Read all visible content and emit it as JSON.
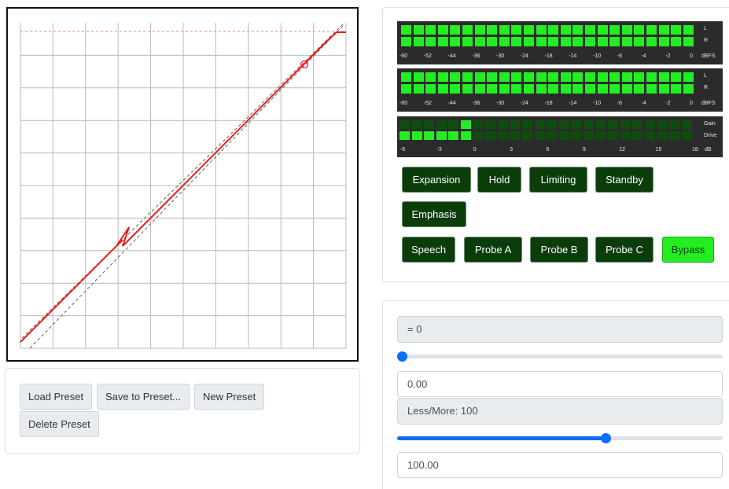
{
  "graph": {
    "grid_columns": 10,
    "grid_rows": 10
  },
  "presets": {
    "load": "Load Preset",
    "save": "Save to Preset...",
    "new": "New Preset",
    "delete": "Delete Preset"
  },
  "meters": {
    "output_1": {
      "channels": [
        "L",
        "R"
      ],
      "scale": [
        "-60",
        "-52",
        "-44",
        "-36",
        "-30",
        "-24",
        "-18",
        "-14",
        "-10",
        "-6",
        "-4",
        "-2",
        "0"
      ],
      "unit": "dBFS",
      "lit_fraction": 1.0
    },
    "output_2": {
      "channels": [
        "L",
        "R"
      ],
      "scale": [
        "-60",
        "-52",
        "-44",
        "-36",
        "-30",
        "-24",
        "-18",
        "-14",
        "-10",
        "-6",
        "-4",
        "-2",
        "0"
      ],
      "unit": "dBFS",
      "lit_fraction": 1.0
    },
    "gain_drive": {
      "channels": [
        "Gain",
        "Drive"
      ],
      "scale": [
        "-6",
        "-3",
        "0",
        "3",
        "6",
        "9",
        "12",
        "15",
        "18"
      ],
      "unit": "dB",
      "gain_lit_segments": 1,
      "drive_lit_segments": 6
    },
    "colors": {
      "lit": "#22ee22",
      "dim": "#0e4d0e",
      "bg": "#2b2b2b"
    }
  },
  "modes": {
    "row1": [
      "Expansion",
      "Hold",
      "Limiting",
      "Standby"
    ],
    "row2": [
      "Emphasis"
    ],
    "row3": [
      "Speech",
      "Probe A",
      "Probe B",
      "Probe C",
      "Bypass"
    ],
    "active": "Bypass"
  },
  "controls": {
    "param1_label": "= 0",
    "param1_value": "0.00",
    "param1_fraction": 0.0,
    "param2_label": "Less/More: 100",
    "param2_value": "100.00",
    "param2_fraction": 0.64
  }
}
